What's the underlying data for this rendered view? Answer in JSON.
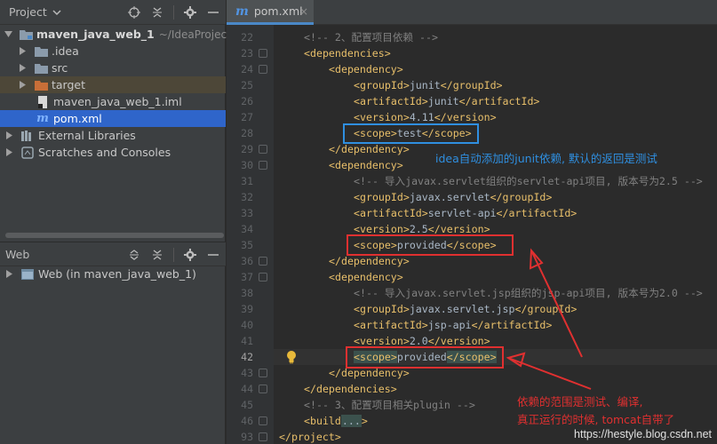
{
  "project_panel": {
    "title": "Project",
    "tree": [
      {
        "label": "maven_java_web_1",
        "path": "~/IdeaProjects",
        "kind": "module"
      },
      {
        "label": ".idea",
        "kind": "folder"
      },
      {
        "label": "src",
        "kind": "folder"
      },
      {
        "label": "target",
        "kind": "folder-excluded"
      },
      {
        "label": "maven_java_web_1.iml",
        "kind": "file-iml"
      },
      {
        "label": "pom.xml",
        "kind": "file-maven",
        "selected": true
      },
      {
        "label": "External Libraries",
        "kind": "libraries"
      },
      {
        "label": "Scratches and Consoles",
        "kind": "scratches"
      }
    ]
  },
  "web_panel": {
    "title": "Web",
    "tree": [
      {
        "label": "Web (in maven_java_web_1)",
        "kind": "web"
      }
    ]
  },
  "editor": {
    "tab_label": "pom.xml",
    "tab_icon": "m",
    "tab_close": "×",
    "current_line": "42",
    "lines": [
      {
        "n": "22"
      },
      {
        "n": "23"
      },
      {
        "n": "24"
      },
      {
        "n": "25"
      },
      {
        "n": "26"
      },
      {
        "n": "27"
      },
      {
        "n": "28"
      },
      {
        "n": "29"
      },
      {
        "n": "30"
      },
      {
        "n": "31"
      },
      {
        "n": "32"
      },
      {
        "n": "33"
      },
      {
        "n": "34"
      },
      {
        "n": "35"
      },
      {
        "n": "36"
      },
      {
        "n": "37"
      },
      {
        "n": "38"
      },
      {
        "n": "39"
      },
      {
        "n": "40"
      },
      {
        "n": "41"
      },
      {
        "n": "42"
      },
      {
        "n": "43"
      },
      {
        "n": "44"
      },
      {
        "n": "45"
      },
      {
        "n": "46"
      },
      {
        "n": "93"
      }
    ],
    "code": {
      "l22": "<!-- 2、配置项目依赖 -->",
      "dependencies_open": "<dependencies>",
      "dependency_open": "<dependency>",
      "dependency_close": "</dependency>",
      "groupId_open": "<groupId>",
      "groupId_close": "</groupId>",
      "artifactId_open": "<artifactId>",
      "artifactId_close": "</artifactId>",
      "version_open": "<version>",
      "version_close": "</version>",
      "scope_open": "<scope>",
      "scope_close": "</scope>",
      "junit_group": "junit",
      "junit_artifact": "junit",
      "junit_version": "4.11",
      "junit_scope": "test",
      "servlet_comment": "<!-- 导入javax.servlet组织的servlet-api项目, 版本号为2.5 -->",
      "servlet_group": "javax.servlet",
      "servlet_artifact": "servlet-api",
      "servlet_version": "2.5",
      "servlet_scope": "provided",
      "jsp_comment": "<!-- 导入javax.servlet.jsp组织的jsp-api项目, 版本号为2.0 -->",
      "jsp_group": "javax.servlet.jsp",
      "jsp_artifact": "jsp-api",
      "jsp_version": "2.0",
      "jsp_scope": "provided",
      "dependencies_close": "</dependencies>",
      "l45": "<!-- 3、配置项目相关plugin -->",
      "build_open": "<build",
      "build_ellipsis": "...",
      "build_close": ">",
      "project_close": "</project>"
    }
  },
  "annotations": {
    "junit_note": "idea自动添加的junit依赖, 默认的返回是测试",
    "scope_note_1": "依赖的范围是测试、编译,",
    "scope_note_2": "真正运行的时候, tomcat自带了",
    "junit_note_color": "#2f8fe0",
    "scope_note_color": "#e03030",
    "blue_box_color": "#2f8fe0",
    "red_box_color": "#e03030"
  },
  "watermark": "https://hestyle.blog.csdn.net"
}
